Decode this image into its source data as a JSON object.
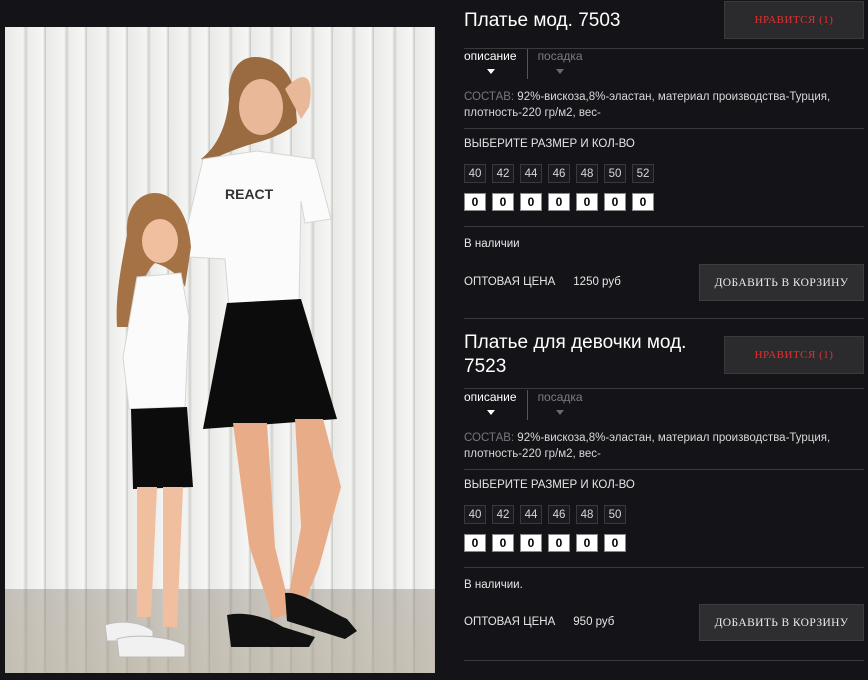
{
  "products": [
    {
      "title": "Платье мод. 7503",
      "like_label": "НРАВИТСЯ (1)",
      "tabs": [
        "описание",
        "посадка"
      ],
      "composition_label": "СОСТАВ:",
      "composition_text": " 92%-вискоза,8%-эластан, материал производства-Турция, плотность-220 гр/м2, вес-",
      "size_heading": "ВЫБЕРИТЕ РАЗМЕР И КОЛ-ВО",
      "sizes": [
        "40",
        "42",
        "44",
        "46",
        "48",
        "50",
        "52"
      ],
      "quantities": [
        "0",
        "0",
        "0",
        "0",
        "0",
        "0",
        "0"
      ],
      "stock": "В наличии",
      "price_label": "ОПТОВАЯ ЦЕНА",
      "price_value": "1250 руб",
      "cart_label": "ДОБАВИТЬ В КОРЗИНУ"
    },
    {
      "title": "Платье для девочки мод. 7523",
      "like_label": "НРАВИТСЯ (1)",
      "tabs": [
        "описание",
        "посадка"
      ],
      "composition_label": "СОСТАВ:",
      "composition_text": " 92%-вискоза,8%-эластан, материал производства-Турция, плотность-220 гр/м2, вес-",
      "size_heading": "ВЫБЕРИТЕ РАЗМЕР И КОЛ-ВО",
      "sizes": [
        "40",
        "42",
        "44",
        "46",
        "48",
        "50"
      ],
      "quantities": [
        "0",
        "0",
        "0",
        "0",
        "0",
        "0"
      ],
      "stock": "В наличии.",
      "price_label": "ОПТОВАЯ ЦЕНА",
      "price_value": "950 руб",
      "cart_label": "ДОБАВИТЬ В КОРЗИНУ"
    }
  ],
  "colors": {
    "background": "#141418",
    "like_text": "#e0302f",
    "button_bg": "#2e2e31"
  }
}
